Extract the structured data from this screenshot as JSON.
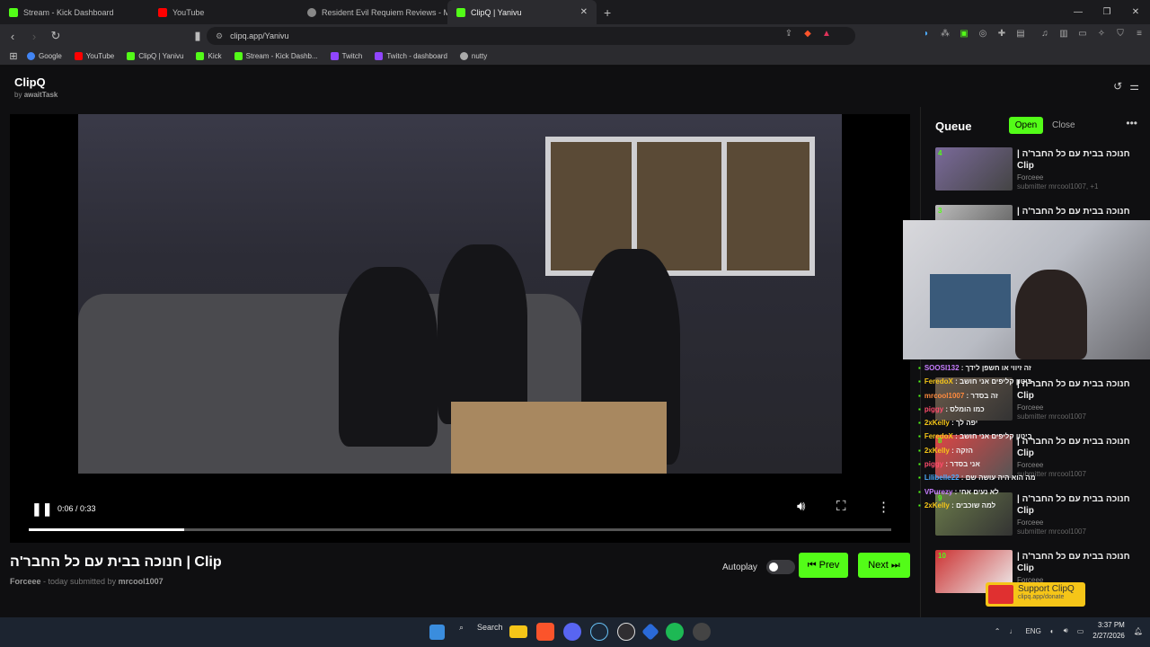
{
  "browser": {
    "tabs": [
      {
        "label": "Stream - Kick Dashboard",
        "color": "#53fc18"
      },
      {
        "label": "YouTube",
        "color": "#ff0000"
      },
      {
        "label": "Resident Evil Requiem Reviews - Met",
        "color": "#888888"
      },
      {
        "label": "ClipQ | Yanivu",
        "color": "#53fc18"
      }
    ],
    "url": "clipq.app/Yanivu",
    "bookmarks": [
      {
        "label": "Google",
        "color": "#4285f4"
      },
      {
        "label": "YouTube",
        "color": "#ff0000"
      },
      {
        "label": "ClipQ | Yanivu",
        "color": "#53fc18"
      },
      {
        "label": "Kick",
        "color": "#53fc18"
      },
      {
        "label": "Stream - Kick Dashb...",
        "color": "#53fc18"
      },
      {
        "label": "Twitch",
        "color": "#9146ff"
      },
      {
        "label": "Twitch - dashboard",
        "color": "#9146ff"
      },
      {
        "label": "nutty",
        "color": "#aaaaaa"
      }
    ]
  },
  "app": {
    "name": "ClipQ",
    "by_prefix": "by",
    "by": "awaitTask"
  },
  "player": {
    "time": "0:06 / 0:33",
    "progress": 0.18,
    "title": "חנוכה בבית עם כל החבר'ה | Clip",
    "author": "Forceee",
    "meta_mid": " - today submitted by ",
    "submitter": "mrcool1007",
    "autoplay_label": "Autoplay",
    "autoplay_on": false,
    "prev_label": "Prev",
    "next_label": "Next"
  },
  "queue": {
    "title": "Queue",
    "open_label": "Open",
    "close_label": "Close",
    "items": [
      {
        "num": "4",
        "title": "חנוכה בבית עם כל החבר'ה | Clip",
        "author": "Forceee",
        "sub": "submitter mrcool1007, +1"
      },
      {
        "num": "3",
        "title": "חנוכה בבית עם כל החבר'ה |",
        "author": "",
        "sub": ""
      },
      {
        "num": "",
        "title": "חנוכה בבית עם כל החבר'ה | Clip",
        "author": "Forceee",
        "sub": "submitter mrcool1007"
      },
      {
        "num": "8",
        "title": "חנוכה בבית עם כל החבר'ה | Clip",
        "author": "Forceee",
        "sub": "submitter mrcool1007"
      },
      {
        "num": "9",
        "title": "חנוכה בבית עם כל החבר'ה | Clip",
        "author": "Forceee",
        "sub": "submitter mrcool1007"
      },
      {
        "num": "10",
        "title": "חנוכה בבית עם כל החבר'ה | Clip",
        "author": "Forceee",
        "sub": ""
      }
    ]
  },
  "chat": [
    {
      "user": "SOOSI132",
      "msg": "זה זיווי או חשפן לידך",
      "color": "#c77dff"
    },
    {
      "user": "FeredoX",
      "msg": "ביטון קליפים אני חושב",
      "color": "#f5c518"
    },
    {
      "user": "mrcool1007",
      "msg": "זה בסדר",
      "color": "#ff8a3d"
    },
    {
      "user": "piggy",
      "msg": "כמו הומלס",
      "color": "#ff4d6d"
    },
    {
      "user": "2xKelly",
      "msg": "יפה לך",
      "color": "#f5c518"
    },
    {
      "user": "FeredoX",
      "msg": "ביטון קליפים אני חושב",
      "color": "#f5c518"
    },
    {
      "user": "2xKelly",
      "msg": "הזקה",
      "color": "#f5c518"
    },
    {
      "user": "piggy",
      "msg": "אני בסדר",
      "color": "#ff4d6d"
    },
    {
      "user": "Lilibelle22",
      "msg": "מה הוא היה עושה שם",
      "color": "#4dabff"
    },
    {
      "user": "VPurezy",
      "msg": "לא נעים אחי",
      "color": "#c77dff"
    },
    {
      "user": "2xKelly",
      "msg": "למה שוכבים",
      "color": "#f5c518"
    }
  ],
  "support": {
    "label": "Support ClipQ",
    "url": "clipq.app/donate"
  },
  "taskbar": {
    "search": "Search",
    "lang": "ENG",
    "time": "3:37 PM",
    "date": "2/27/2026"
  }
}
